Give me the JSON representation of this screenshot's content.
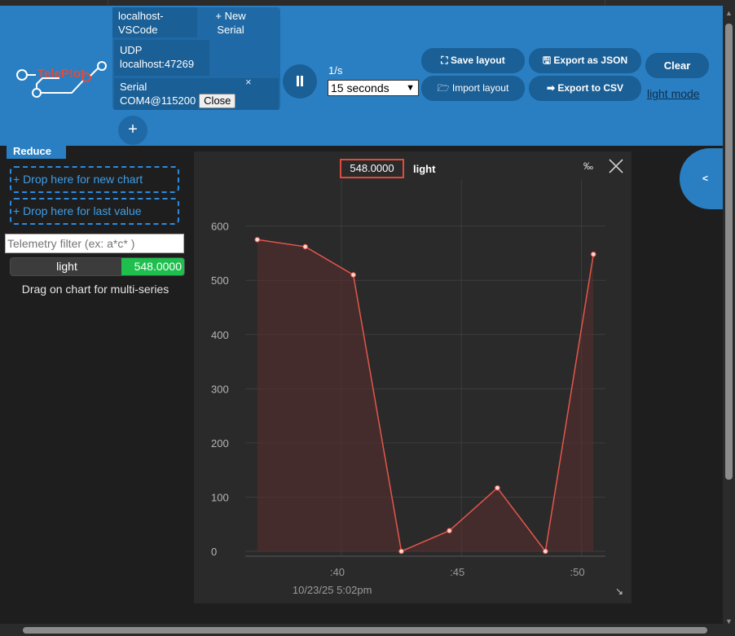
{
  "logo": {
    "text": "TeleP!ot"
  },
  "connections": [
    {
      "name": "localhost-VSCode",
      "line1": "localhost-",
      "line2": "VSCode"
    },
    {
      "label": "+ New",
      "label2": "Serial"
    },
    {
      "type": "UDP",
      "detail": "localhost:47269"
    },
    {
      "type": "Serial",
      "detail": "COM4@115200",
      "close_label": "Close",
      "remove_symbol": "×"
    }
  ],
  "add_connection": "+",
  "controls": {
    "rate": "1/s",
    "period": "15 seconds"
  },
  "buttons": {
    "save_layout": "⛶ Save layout",
    "import_layout": "🗁 Import layout",
    "export_json": "🖫 Export as JSON",
    "export_csv": "➡ Export to CSV",
    "clear": "Clear",
    "theme_link": "light mode"
  },
  "sidebar": {
    "reduce": "Reduce",
    "drop_new_chart": "+ Drop here for new chart",
    "drop_last_value": "+ Drop here for last value",
    "filter_placeholder": "Telemetry filter (ex: a*c* )",
    "telemetry": [
      {
        "name": "light",
        "value": "548.0000"
      }
    ],
    "drag_hint": "Drag on chart for multi-series"
  },
  "collapse_symbol": "<",
  "chart_header": {
    "current_value": "548.0000",
    "series_name": "light",
    "permille_symbol": "‰"
  },
  "chart_data": {
    "type": "area",
    "title": "",
    "xlabel": "10/23/25 5:02pm",
    "ylabel": "",
    "x": [
      36.5,
      38.5,
      40.5,
      42.5,
      44.5,
      46.5,
      48.5,
      50.5
    ],
    "x_tick_labels": [
      ":40",
      ":45",
      ":50"
    ],
    "x_tick_values": [
      40,
      45,
      50
    ],
    "xlim": [
      36.0,
      51.0
    ],
    "y_ticks": [
      0,
      100,
      200,
      300,
      400,
      500,
      600
    ],
    "ylim": [
      0,
      640
    ],
    "grid": true,
    "series": [
      {
        "name": "light",
        "color": "#e3564a",
        "fill": "#5a2e2e",
        "values": [
          575,
          562,
          510,
          0,
          38,
          117,
          0,
          548
        ]
      }
    ]
  },
  "colors": {
    "header_bg": "#2a7fc2",
    "button_bg": "#1a5f96",
    "chart_bg": "#2a2a2a",
    "value_badge": "#1fbf4e"
  }
}
